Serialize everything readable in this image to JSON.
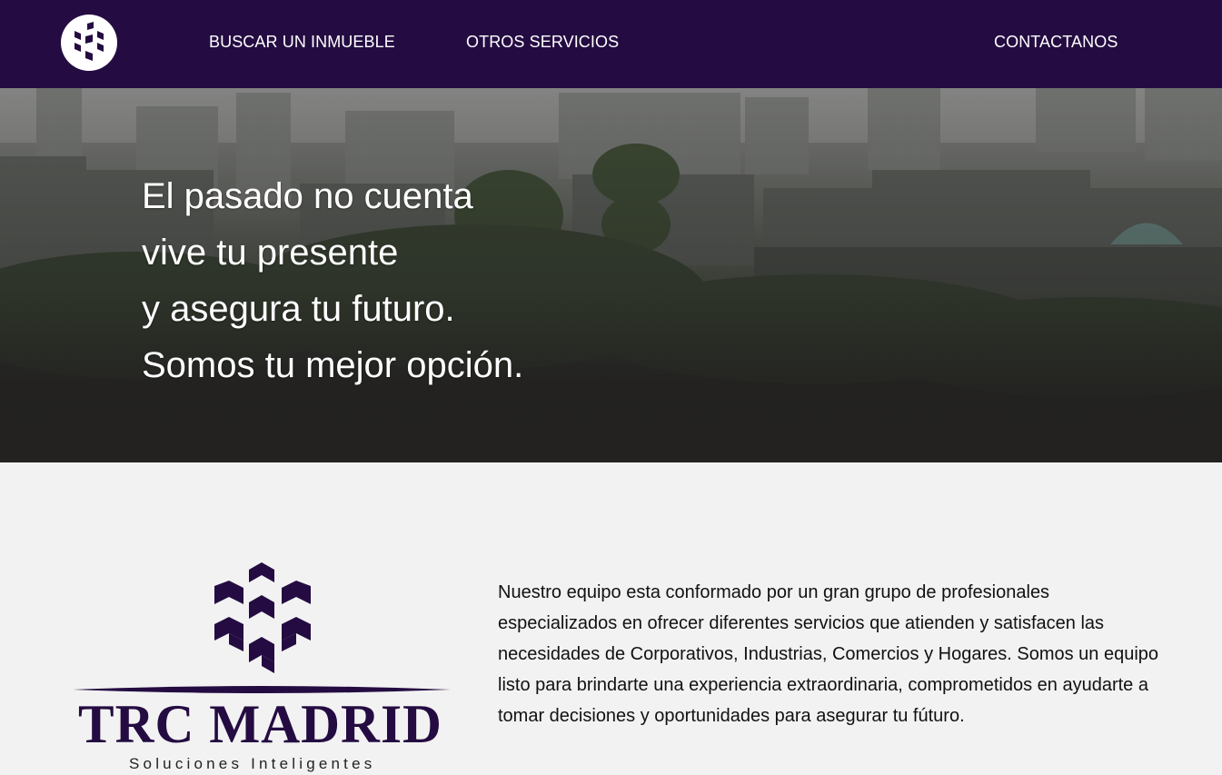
{
  "nav": {
    "logo_icon": "cube-cluster-logo-icon",
    "links": [
      "BUSCAR UN INMUEBLE",
      "OTROS SERVICIOS",
      "CONTACTANOS"
    ]
  },
  "hero": {
    "lines": [
      "El pasado no cuenta",
      "vive tu presente",
      "y asegura tu futuro.",
      "Somos tu mejor opción."
    ]
  },
  "about": {
    "brand_name": "TRC MADRID",
    "brand_tagline": "Soluciones Inteligentes",
    "description": "Nuestro equipo esta conformado por un gran grupo de profesionales especializados en ofrecer diferentes servicios que atienden y satisfacen las necesidades de Corporativos, Industrias, Comercios y Hogares. Somos un equipo listo para brindarte una experiencia extraordinaria, comprometidos en ayudarte a tomar decisiones y oportunidades para asegurar tu fúturo."
  },
  "colors": {
    "nav_bg": "#240c42",
    "brand": "#240c42",
    "page_bg": "#f2f2f2",
    "hero_text": "#ffffff"
  }
}
